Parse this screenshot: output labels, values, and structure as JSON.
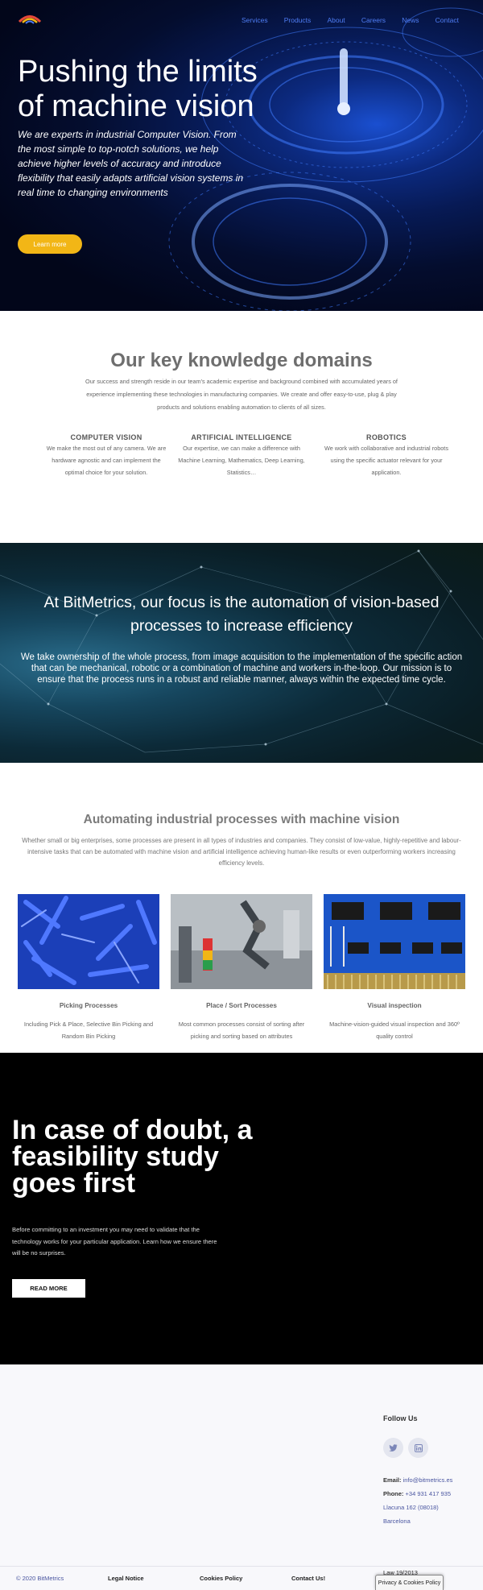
{
  "nav": {
    "logo_text": "BitMetrics",
    "items": [
      "Services",
      "Products",
      "About",
      "Careers",
      "News",
      "Contact"
    ]
  },
  "hero": {
    "title": "Pushing the limits of machine vision",
    "lead": "We are experts in industrial Computer Vision. From the most simple to top-notch solutions, we help achieve higher levels of accuracy and introduce flexibility that easily adapts artificial vision systems in real time to changing environments",
    "button": "Learn more"
  },
  "knowledge": {
    "title": "Our key knowledge domains",
    "intro": "Our success and strength reside in our team's academic expertise and background combined with accumulated years of experience implementing these technologies in manufacturing companies. We create and offer easy-to-use, plug & play products and solutions enabling automation to clients of all sizes.",
    "columns": [
      {
        "title": "COMPUTER VISION",
        "text": "We make the most out of any camera. We are hardware agnostic and can implement the optimal choice for your solution."
      },
      {
        "title": "ARTIFICIAL INTELLIGENCE",
        "text": "Our expertise, we can make a difference with Machine Learning, Mathematics, Deep Learning, Statistics…"
      },
      {
        "title": "ROBOTICS",
        "text": "We work with collaborative and industrial robots using the specific actuator relevant for your application."
      }
    ]
  },
  "focus": {
    "title": "At BitMetrics, our focus is the automation of vision-based processes to increase efficiency",
    "text": "We take ownership of the whole process, from image acquisition to the implementation of the specific action that can be mechanical, robotic or a combination of machine and workers in-the-loop. Our mission is to ensure that the process runs in a robust and reliable manner, always within the expected time cycle."
  },
  "automating": {
    "title": "Automating industrial processes with machine vision",
    "subtitle": "Whether small or big enterprises, some processes are present in all types of industries and companies. They consist of low-value, highly-repetitive and labour-intensive tasks that can be automated with machine vision and artificial intelligence achieving human-like results or even outperforming workers increasing efficiency levels.",
    "cards": [
      {
        "title": "Picking Processes",
        "text": "Including Pick & Place, Selective Bin Picking and Random Bin Picking",
        "image": "blue-plastic-parts"
      },
      {
        "title": "Place / Sort Processes",
        "text": "Most common processes consist of sorting after picking and sorting based on attributes",
        "image": "robot-arm"
      },
      {
        "title": "Visual inspection",
        "text": "Machine-vision-guided visual inspection and 360º quality control",
        "image": "circuit-board"
      }
    ]
  },
  "feasibility": {
    "title": "In case of doubt, a feasibility study goes first",
    "text": "Before committing to an investment you may need to validate that the technology works for your particular application. Learn how we ensure there will be no surprises.",
    "button": "READ MORE"
  },
  "footer": {
    "follow": "Follow Us",
    "social": [
      "twitter-icon",
      "linkedin-icon"
    ],
    "email_label": "Email:",
    "email": "info@bitmetrics.es",
    "phone_label": "Phone:",
    "phone": "+34 931 417 935",
    "address": "Llacuna 162 (08018)",
    "city": "Barcelona"
  },
  "bottom": {
    "copyright": "© 2020 BitMetrics",
    "links": [
      "Legal Notice",
      "Cookies Policy",
      "Contact Us!"
    ],
    "law": "Law 19/2013",
    "cookie_button": "Privacy & Cookies Policy"
  },
  "colors": {
    "nav_link": "#4f7df4",
    "accent_yellow": "#f2b616",
    "footer_link": "#4a56a0"
  }
}
